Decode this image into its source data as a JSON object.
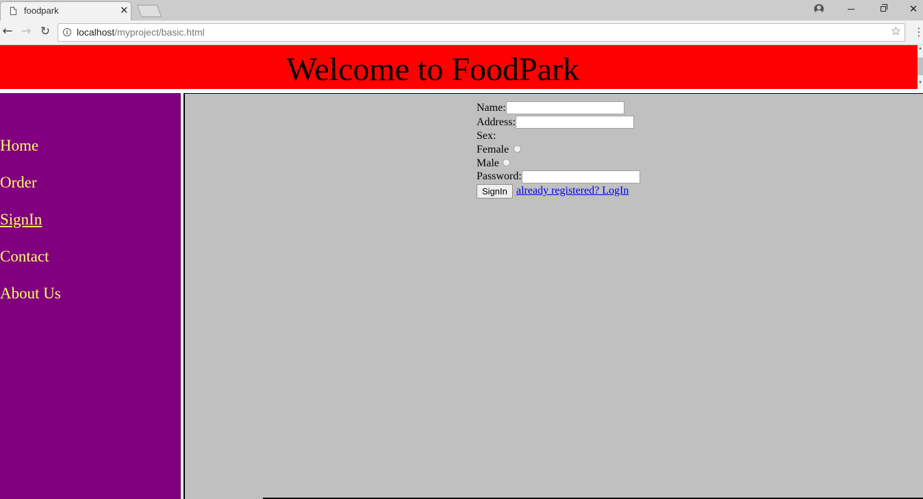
{
  "browser": {
    "tab_title": "foodpark",
    "url_host": "localhost",
    "url_path": "/myproject/basic.html"
  },
  "page": {
    "header_title": "Welcome to FoodPark",
    "colors": {
      "header_bg": "#ff0000",
      "sidebar_bg": "#800080",
      "sidebar_text": "#ffff66",
      "main_bg": "#c0c0c0"
    },
    "sidebar": {
      "items": [
        {
          "label": "Home"
        },
        {
          "label": "Order"
        },
        {
          "label": "SignIn"
        },
        {
          "label": "Contact"
        },
        {
          "label": "About Us"
        }
      ]
    },
    "form": {
      "name_label": "Name:",
      "name_value": "",
      "address_label": "Address:",
      "address_value": "",
      "sex_label": "Sex:",
      "female_label": "Female",
      "male_label": "Male",
      "password_label": "Password:",
      "password_value": "",
      "submit_label": "SignIn",
      "login_link": "already registered? LogIn"
    }
  }
}
